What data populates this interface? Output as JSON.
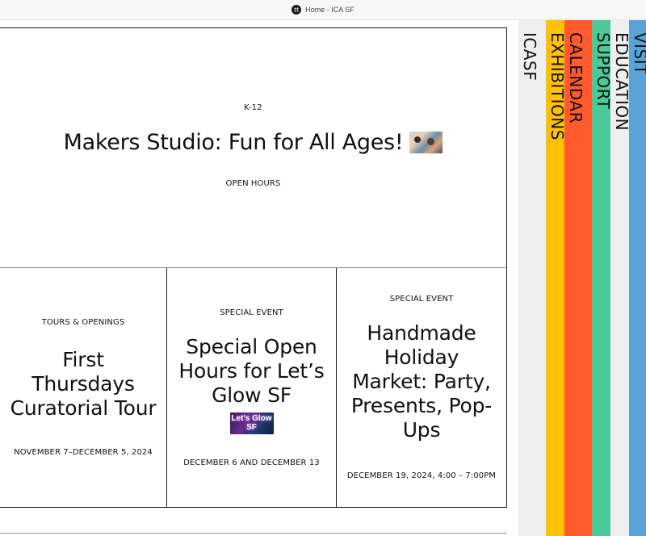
{
  "window": {
    "title": "Home - ICA SF"
  },
  "hero": {
    "tag": "K-12",
    "title": "Makers Studio: Fun for All Ages!",
    "subtitle": "OPEN HOURS"
  },
  "cards": [
    {
      "label": "TOURS & OPENINGS",
      "title": "First Thursdays Curatorial Tour",
      "date": "NOVEMBER 7–DECEMBER 5, 2024"
    },
    {
      "label": "SPECIAL EVENT",
      "title": "Special Open Hours for Let’s Glow SF",
      "image_text": "Let's Glow SF",
      "date": "DECEMBER 6 AND DECEMBER 13"
    },
    {
      "label": "SPECIAL EVENT",
      "title": "Handmade Holiday Market: Party, Presents, Pop-Ups",
      "date": "DECEMBER 19, 2024, 4:00 – 7:00PM"
    }
  ],
  "nav": {
    "items": [
      {
        "label": "ICASF",
        "color": "#efefef"
      },
      {
        "label": "EXHIBITIONS",
        "color": "#ffc107"
      },
      {
        "label": "CALENDAR",
        "color": "#ff5a2d"
      },
      {
        "label": "SUPPORT",
        "color": "#4cc99b"
      },
      {
        "label": "EDUCATION",
        "color": "#efefef"
      },
      {
        "label": "VISIT",
        "color": "#5aa3d6"
      }
    ]
  }
}
